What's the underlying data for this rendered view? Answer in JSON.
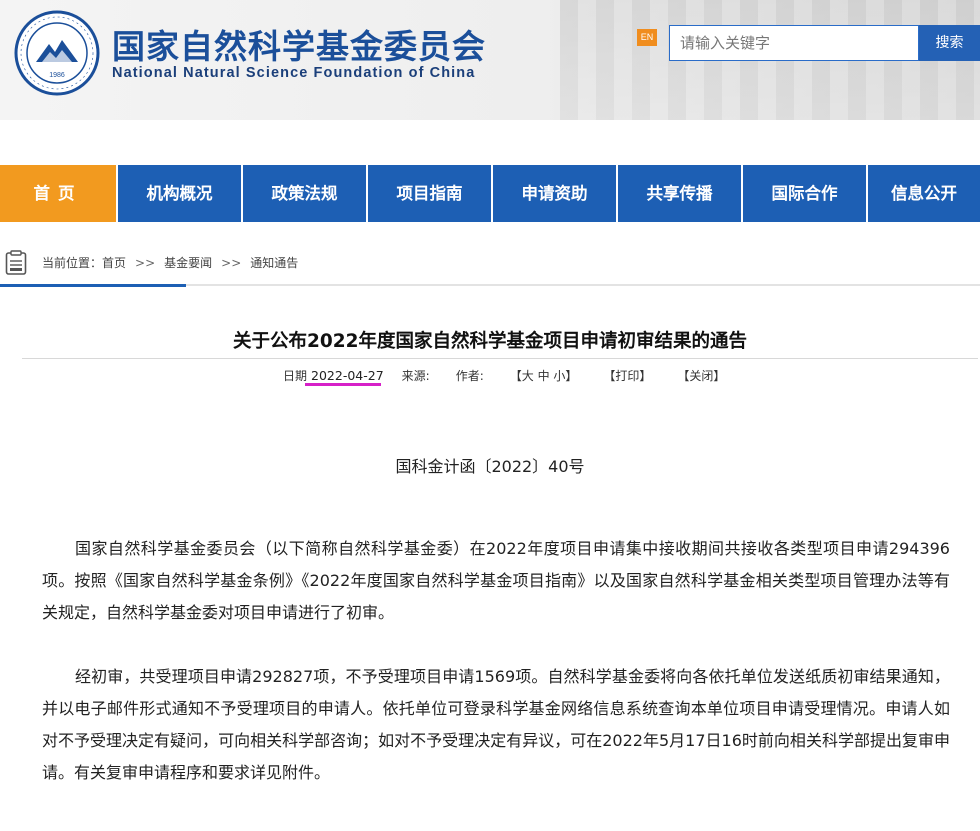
{
  "header": {
    "logo_text_cn": "国家自然科学基金委员会",
    "logo_text_en": "National Natural Science Foundation of China",
    "seal_year": "1986",
    "en_badge": "EN",
    "search_placeholder": "请输入关键字",
    "search_button": "搜索"
  },
  "nav": {
    "items": [
      {
        "label": "首页"
      },
      {
        "label": "机构概况"
      },
      {
        "label": "政策法规"
      },
      {
        "label": "项目指南"
      },
      {
        "label": "申请资助"
      },
      {
        "label": "共享传播"
      },
      {
        "label": "国际合作"
      },
      {
        "label": "信息公开"
      }
    ],
    "active_color": "#f29a1f",
    "bar_color": "#1d5fb4"
  },
  "breadcrumb": {
    "prefix": "当前位置：",
    "items": [
      "首页",
      "基金要闻",
      "通知通告"
    ],
    "separator": ">>"
  },
  "article": {
    "title": "关于公布2022年度国家自然科学基金项目申请初审结果的通告",
    "meta": {
      "date_label": "日期",
      "date": "2022-04-27",
      "source_label": "来源:",
      "author_label": "作者:",
      "font_size": "【大 中 小】",
      "print": "【打印】",
      "close": "【关闭】"
    },
    "doc_number": "国科金计函〔2022〕40号",
    "paragraphs": [
      "国家自然科学基金委员会（以下简称自然科学基金委）在2022年度项目申请集中接收期间共接收各类型项目申请294396项。按照《国家自然科学基金条例》《2022年度国家自然科学基金项目指南》以及国家自然科学基金相关类型项目管理办法等有关规定，自然科学基金委对项目申请进行了初审。",
      "经初审，共受理项目申请292827项，不予受理项目申请1569项。自然科学基金委将向各依托单位发送纸质初审结果通知，并以电子邮件形式通知不予受理项目的申请人。依托单位可登录科学基金网络信息系统查询本单位项目申请受理情况。申请人如对不予受理决定有疑问，可向相关科学部咨询；如对不予受理决定有异议，可在2022年5月17日16时前向相关科学部提出复审申请。有关复审申请程序和要求详见附件。"
    ]
  }
}
